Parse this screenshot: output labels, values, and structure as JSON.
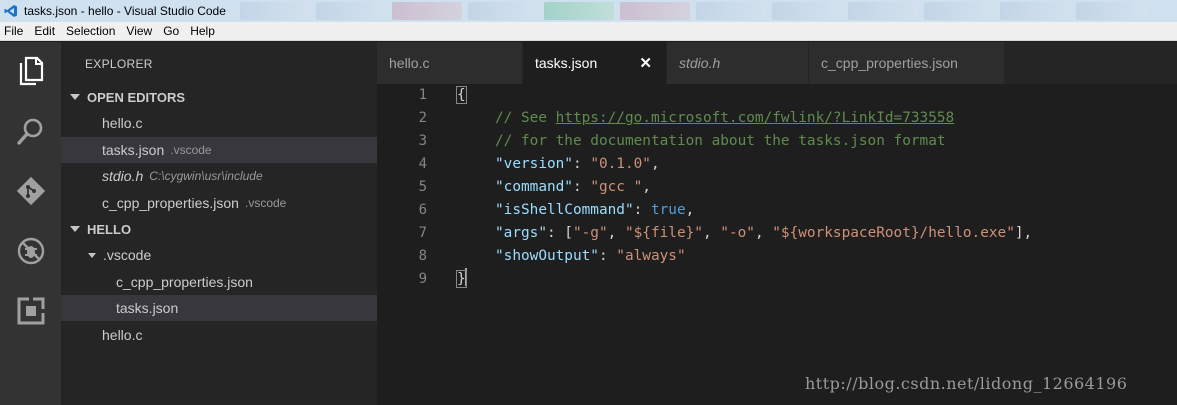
{
  "window": {
    "title": "tasks.json - hello - Visual Studio Code"
  },
  "menu": [
    "File",
    "Edit",
    "Selection",
    "View",
    "Go",
    "Help"
  ],
  "activity_icons": [
    "files-icon",
    "search-icon",
    "git-icon",
    "debug-icon",
    "extensions-icon"
  ],
  "explorer": {
    "title": "EXPLORER",
    "open_editors_header": "OPEN EDITORS",
    "open_editors": [
      {
        "name": "hello.c",
        "desc": ""
      },
      {
        "name": "tasks.json",
        "desc": ".vscode"
      },
      {
        "name": "stdio.h",
        "desc": "C:\\cygwin\\usr\\include"
      },
      {
        "name": "c_cpp_properties.json",
        "desc": ".vscode"
      }
    ],
    "folder_header": "HELLO",
    "tree": {
      "folder": ".vscode",
      "children": [
        "c_cpp_properties.json",
        "tasks.json"
      ],
      "root_file": "hello.c"
    }
  },
  "tabs": [
    {
      "label": "hello.c"
    },
    {
      "label": "tasks.json",
      "close": "✕"
    },
    {
      "label": "stdio.h"
    },
    {
      "label": "c_cpp_properties.json"
    }
  ],
  "editor": {
    "line_numbers": [
      "1",
      "2",
      "3",
      "4",
      "5",
      "6",
      "7",
      "8",
      "9"
    ],
    "lines": {
      "l1": "{",
      "l2_comment": "// See ",
      "l2_url": "https://go.microsoft.com/fwlink/?LinkId=733558",
      "l3_comment": "// for the documentation about the tasks.json format",
      "l4_key": "\"version\"",
      "l4_val": "\"0.1.0\"",
      "l5_key": "\"command\"",
      "l5_val": "\"gcc \"",
      "l6_key": "\"isShellCommand\"",
      "l6_val": "true",
      "l7_key": "\"args\"",
      "l7_v1": "\"-g\"",
      "l7_v2": "\"${file}\"",
      "l7_v3": "\"-o\"",
      "l7_v4": "\"${workspaceRoot}/hello.exe\"",
      "l8_key": "\"showOutput\"",
      "l8_val": "\"always\"",
      "l9": "}"
    }
  },
  "watermark": "http://blog.csdn.net/lidong_12664196",
  "colors": {
    "accent_comment": "#608b4e",
    "key": "#9cdcfe",
    "string": "#ce9178",
    "bool": "#569cd6"
  }
}
